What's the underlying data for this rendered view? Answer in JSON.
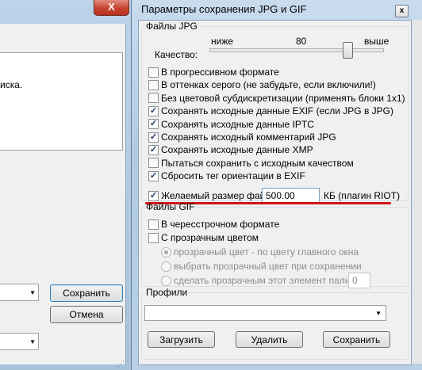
{
  "background_window": {
    "close_glyph": "X",
    "text_fragment": "иска.",
    "buttons": {
      "save": "Сохранить",
      "cancel": "Отмена"
    },
    "combo_arrow": "▼"
  },
  "dialog": {
    "title": "Параметры сохранения JPG и GIF",
    "close_glyph": "x",
    "jpg_group": {
      "legend": "Файлы JPG",
      "quality_label": "Качество:",
      "scale_low": "ниже",
      "scale_value": "80",
      "scale_high": "выше",
      "quality": 80,
      "quality_min": 1,
      "quality_max": 100,
      "options": [
        {
          "label": "В прогрессивном формате",
          "checked": false
        },
        {
          "label": "В оттенках серого (не забудьте, если включили!)",
          "checked": false
        },
        {
          "label": "Без цветовой субдискретизации (применять блоки 1x1)",
          "checked": false
        },
        {
          "label": "Сохранять исходные данные EXIF (если JPG в JPG)",
          "checked": true
        },
        {
          "label": "Сохранять исходные данные IPTC",
          "checked": true
        },
        {
          "label": "Сохранять исходный комментарий JPG",
          "checked": true
        },
        {
          "label": "Сохранять исходные данные XMP",
          "checked": true
        },
        {
          "label": "Пытаться сохранить с исходным качеством",
          "checked": false
        },
        {
          "label": "Сбросить тег ориентации в EXIF",
          "checked": true
        }
      ],
      "target_size": {
        "label": "Желаемый размер файла:",
        "checked": true,
        "value": "500.00",
        "unit": "КБ (плагин RIOT)"
      }
    },
    "gif_group": {
      "legend": "Файлы GIF",
      "interlaced_label": "В чересстрочном формате",
      "transparent_label": "С прозрачным цветом",
      "radio_options": [
        {
          "label": "прозрачный цвет - по цвету главного окна",
          "selected": true
        },
        {
          "label": "выбрать прозрачный цвет при сохранении",
          "selected": false
        },
        {
          "label": "сделать прозрачным этот элемент палитры:",
          "selected": false
        }
      ],
      "palette_index": "0"
    },
    "profiles_group": {
      "legend": "Профили",
      "selected": "",
      "buttons": {
        "load": "Загрузить",
        "delete": "Удалить",
        "save": "Сохранить"
      }
    }
  },
  "colors": {
    "highlight_underline": "#d11414"
  }
}
